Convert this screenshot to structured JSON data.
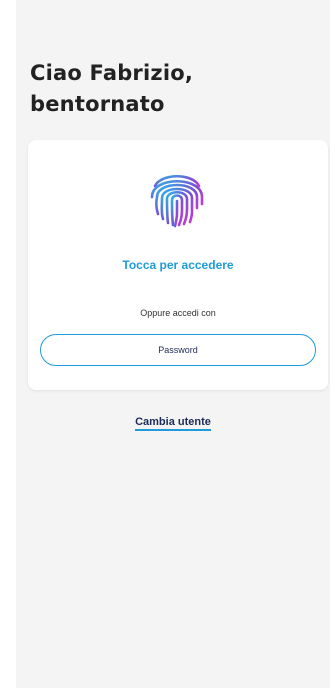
{
  "greeting": {
    "line1": "Ciao Fabrizio,",
    "line2": "bentornato"
  },
  "login_card": {
    "fingerprint_icon": "fingerprint-icon",
    "touch_label": "Tocca per accedere",
    "alternative_label": "Oppure accedi con",
    "password_button_label": "Password"
  },
  "change_user_link": "Cambia utente",
  "colors": {
    "accent_blue": "#1f9bd7",
    "navy_text": "#1d2c57",
    "fingerprint_gradient": [
      "#2bb6e6",
      "#7a4fd6",
      "#c43bd0"
    ],
    "background": "#f4f4f4",
    "card": "#ffffff"
  }
}
